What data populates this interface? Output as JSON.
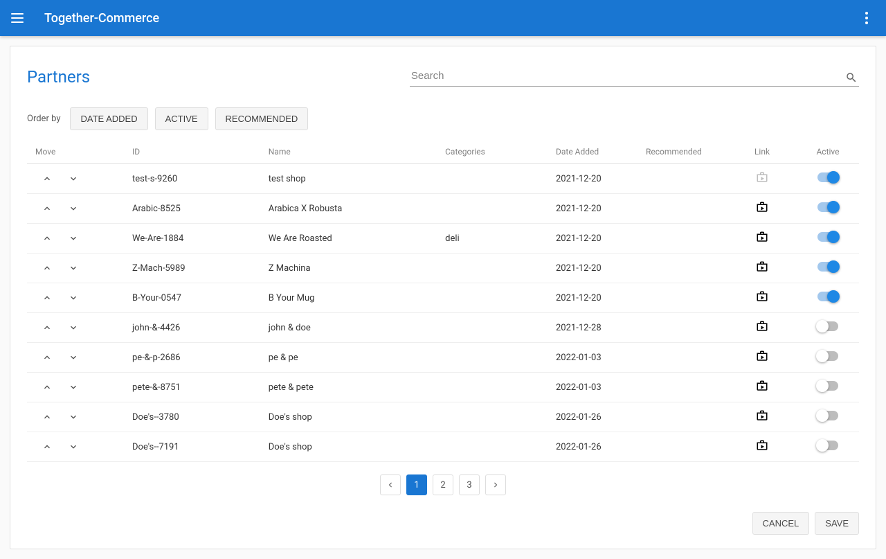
{
  "app": {
    "title": "Together-Commerce"
  },
  "page": {
    "title": "Partners",
    "searchPlaceholder": "Search",
    "orderByLabel": "Order by",
    "orderByButtons": [
      "Date Added",
      "Active",
      "Recommended"
    ],
    "columns": [
      "Move",
      "ID",
      "Name",
      "Categories",
      "Date Added",
      "Recommended",
      "Link",
      "Active"
    ],
    "rows": [
      {
        "id": "test-s-9260",
        "name": "test shop",
        "categories": "",
        "dateAdded": "2021-12-20",
        "recommended": "",
        "linkActive": false,
        "active": true
      },
      {
        "id": "Arabic-8525",
        "name": "Arabica X Robusta",
        "categories": "",
        "dateAdded": "2021-12-20",
        "recommended": "",
        "linkActive": true,
        "active": true
      },
      {
        "id": "We-Are-1884",
        "name": "We Are Roasted",
        "categories": "deli",
        "dateAdded": "2021-12-20",
        "recommended": "",
        "linkActive": true,
        "active": true
      },
      {
        "id": "Z-Mach-5989",
        "name": "Z Machina",
        "categories": "",
        "dateAdded": "2021-12-20",
        "recommended": "",
        "linkActive": true,
        "active": true
      },
      {
        "id": "B-Your-0547",
        "name": "B Your Mug",
        "categories": "",
        "dateAdded": "2021-12-20",
        "recommended": "",
        "linkActive": true,
        "active": true
      },
      {
        "id": "john-&-4426",
        "name": "john & doe",
        "categories": "",
        "dateAdded": "2021-12-28",
        "recommended": "",
        "linkActive": true,
        "active": false
      },
      {
        "id": "pe-&-p-2686",
        "name": "pe & pe",
        "categories": "",
        "dateAdded": "2022-01-03",
        "recommended": "",
        "linkActive": true,
        "active": false
      },
      {
        "id": "pete-&-8751",
        "name": "pete & pete",
        "categories": "",
        "dateAdded": "2022-01-03",
        "recommended": "",
        "linkActive": true,
        "active": false
      },
      {
        "id": "Doe's--3780",
        "name": "Doe's shop",
        "categories": "",
        "dateAdded": "2022-01-26",
        "recommended": "",
        "linkActive": true,
        "active": false
      },
      {
        "id": "Doe's--7191",
        "name": "Doe's shop",
        "categories": "",
        "dateAdded": "2022-01-26",
        "recommended": "",
        "linkActive": true,
        "active": false
      }
    ],
    "pagination": {
      "pages": [
        "1",
        "2",
        "3"
      ],
      "current": 0
    },
    "actions": {
      "cancel": "Cancel",
      "save": "Save"
    }
  }
}
